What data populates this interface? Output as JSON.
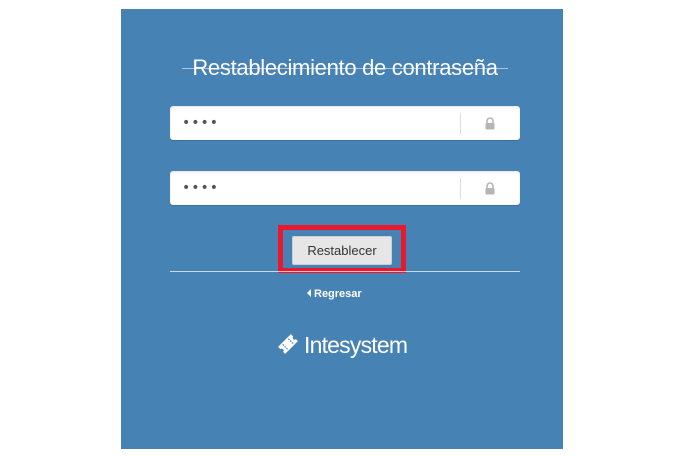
{
  "page": {
    "title": "Restablecimiento de contraseña"
  },
  "form": {
    "password": {
      "value": "****",
      "icon": "lock-icon"
    },
    "confirm_password": {
      "value": "****",
      "icon": "lock-icon"
    },
    "submit_label": "Restablecer",
    "back_label": "Regresar"
  },
  "brand": {
    "name": "Intesystem",
    "icon": "ticket-icon"
  },
  "colors": {
    "panel_background": "#4782b4",
    "highlight": "#e8192c",
    "button_background": "#e6e6e6"
  }
}
